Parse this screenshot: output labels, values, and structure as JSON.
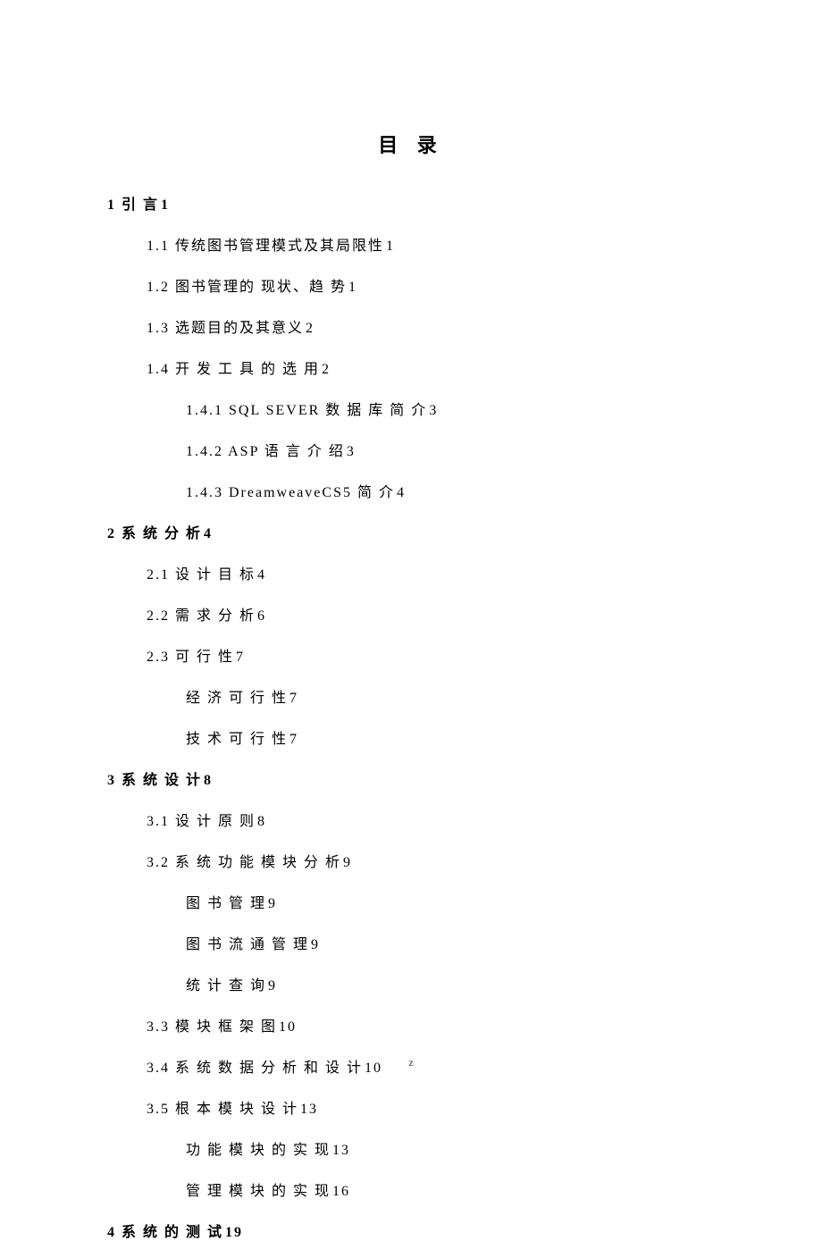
{
  "title": "目 录",
  "footer": "z",
  "entries": [
    {
      "level": 1,
      "text": "1 引 言",
      "page": "1"
    },
    {
      "level": 2,
      "text": "1.1 传统图书管理模式及其局限性",
      "page": "1"
    },
    {
      "level": 2,
      "text": "1.2 图书管理的 现状、趋 势",
      "page": "1"
    },
    {
      "level": 2,
      "text": "1.3 选题目的及其意义",
      "page": "2"
    },
    {
      "level": 2,
      "text": "1.4 开 发 工 具 的 选 用",
      "page": "2"
    },
    {
      "level": 3,
      "text": "1.4.1 SQL SEVER 数 据 库 简 介",
      "page": "3"
    },
    {
      "level": 3,
      "text": "1.4.2 ASP 语 言 介 绍",
      "page": "3"
    },
    {
      "level": 3,
      "text": "1.4.3 DreamweaveCS5 简 介",
      "page": "4"
    },
    {
      "level": 1,
      "text": "2 系 统 分 析",
      "page": "4"
    },
    {
      "level": 2,
      "text": "2.1 设 计 目 标",
      "page": "4"
    },
    {
      "level": 2,
      "text": "2.2 需 求 分 析",
      "page": "6"
    },
    {
      "level": 2,
      "text": "2.3  可 行 性",
      "page": "7"
    },
    {
      "level": 3,
      "text": "经 济 可 行 性",
      "page": "7"
    },
    {
      "level": 3,
      "text": "技 术 可 行 性",
      "page": "7"
    },
    {
      "level": 1,
      "text": "3 系 统 设 计",
      "page": "8"
    },
    {
      "level": 2,
      "text": "3.1 设 计 原 则",
      "page": "8"
    },
    {
      "level": 2,
      "text": "3.2 系 统 功 能 模 块 分 析",
      "page": "9"
    },
    {
      "level": 3,
      "text": "图 书 管 理",
      "page": "9"
    },
    {
      "level": 3,
      "text": "图 书 流 通 管 理",
      "page": "9"
    },
    {
      "level": 3,
      "text": "统 计 查 询",
      "page": "9"
    },
    {
      "level": 2,
      "text": "3.3 模 块 框 架 图",
      "page": "10"
    },
    {
      "level": 2,
      "text": "3.4 系 统 数 据 分 析 和 设 计",
      "page": "10"
    },
    {
      "level": 2,
      "text": "3.5 根 本 模 块 设 计",
      "page": "13"
    },
    {
      "level": 3,
      "text": "功 能 模 块 的 实 现",
      "page": "13"
    },
    {
      "level": 3,
      "text": "管 理 模 块 的 实 现",
      "page": "16"
    },
    {
      "level": 1,
      "text": "4 系 统 的 测 试",
      "page": "19"
    }
  ]
}
